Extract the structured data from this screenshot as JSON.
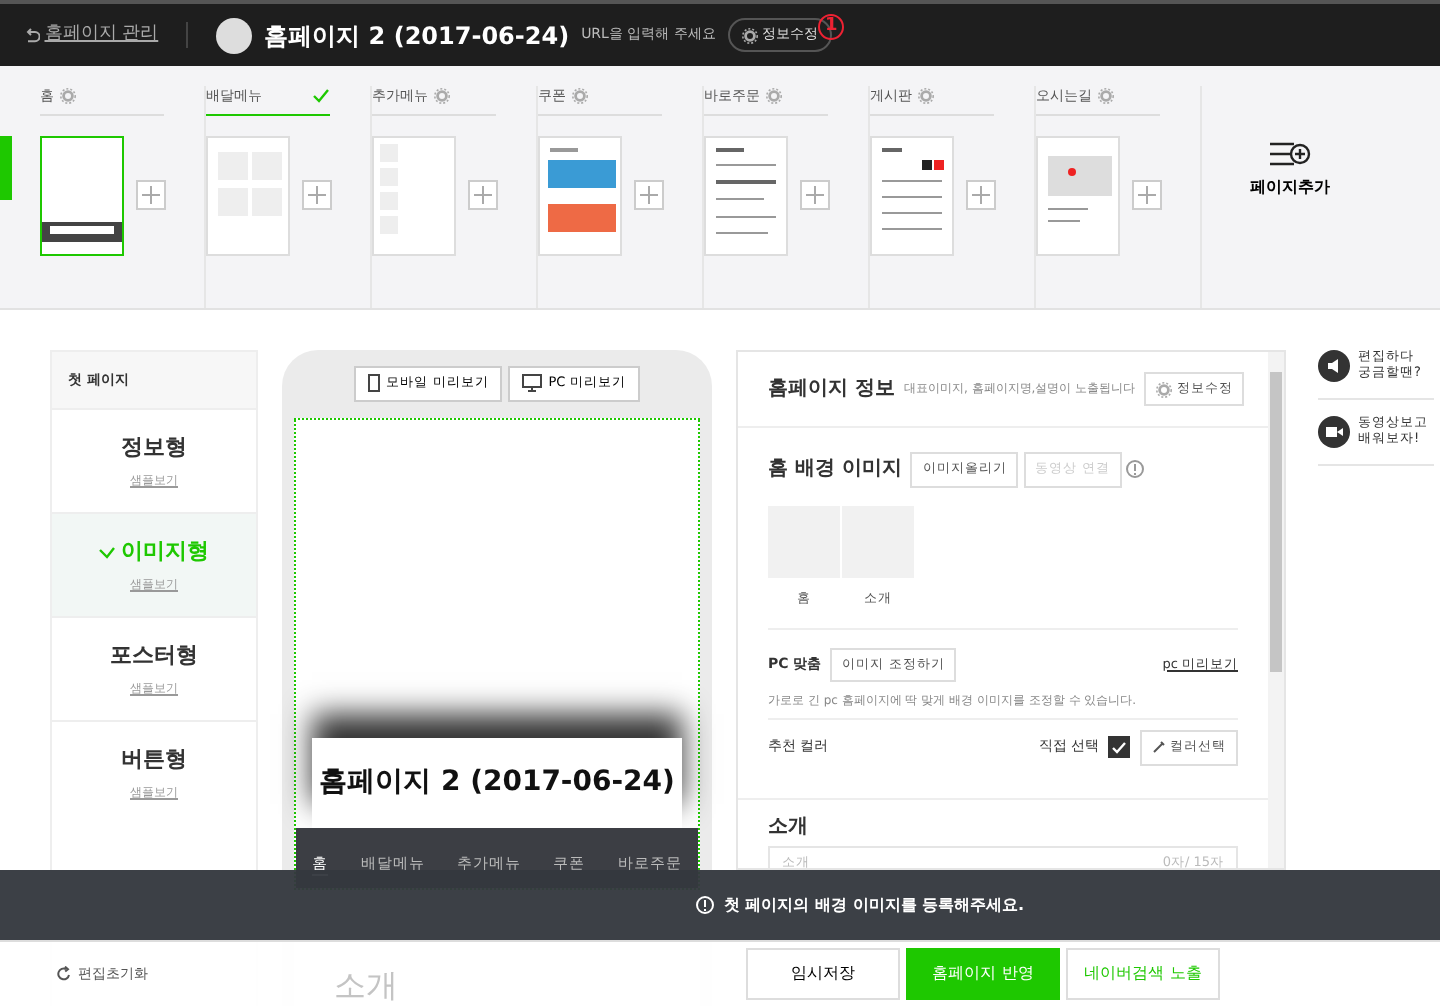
{
  "header": {
    "back_label": "홈페이지 관리",
    "site_title": "홈페이지 2 (2017-06-24)",
    "url_hint": "URL을 입력해 주세요",
    "edit_button": "정보수정",
    "step_marker": "1"
  },
  "pages": [
    {
      "label": "홈",
      "selected": false,
      "current": true,
      "kind": "home"
    },
    {
      "label": "배달메뉴",
      "selected": true,
      "current": false,
      "kind": "grid"
    },
    {
      "label": "추가메뉴",
      "selected": false,
      "current": false,
      "kind": "list"
    },
    {
      "label": "쿠폰",
      "selected": false,
      "current": false,
      "kind": "coupon"
    },
    {
      "label": "바로주문",
      "selected": false,
      "current": false,
      "kind": "order"
    },
    {
      "label": "게시판",
      "selected": false,
      "current": false,
      "kind": "board"
    },
    {
      "label": "오시는길",
      "selected": false,
      "current": false,
      "kind": "map"
    }
  ],
  "add_page": "페이지추가",
  "first_page": {
    "title": "첫 페이지",
    "types": [
      {
        "name": "정보형",
        "sample": "샘플보기",
        "selected": false
      },
      {
        "name": "이미지형",
        "sample": "샘플보기",
        "selected": true
      },
      {
        "name": "포스터형",
        "sample": "샘플보기",
        "selected": false
      },
      {
        "name": "버튼형",
        "sample": "샘플보기",
        "selected": false
      }
    ]
  },
  "preview": {
    "buttons": [
      {
        "label": "모바일 미리보기",
        "kind": "mobile"
      },
      {
        "label": "PC 미리보기",
        "kind": "pc"
      }
    ],
    "site_title": "홈페이지 2 (2017-06-24)",
    "nav": [
      {
        "label": "홈",
        "selected": true
      },
      {
        "label": "배달메뉴",
        "selected": false
      },
      {
        "label": "추가메뉴",
        "selected": false
      },
      {
        "label": "쿠폰",
        "selected": false
      },
      {
        "label": "바로주문",
        "selected": false
      }
    ],
    "section_title": "소개"
  },
  "info_panel": {
    "title": "홈페이지 정보",
    "subtitle": "대표이미지, 홈페이지명,설명이 노출됩니다",
    "edit_button": "정보수정",
    "bg_title": "홈 배경 이미지",
    "upload_button": "이미지올리기",
    "video_button": {
      "label": "동영상 연결",
      "disabled": true
    },
    "thumbs": [
      "홈",
      "소개"
    ],
    "pc_label": "PC 맞춤",
    "adjust_button": "이미지 조정하기",
    "pc_preview_link": "pc 미리보기",
    "pc_desc": "가로로 긴 pc 홈페이지에 딱 맞게 배경 이미지를 조정할 수 있습니다.",
    "color_label": "추천 컬러",
    "direct_label": "직접 선택",
    "direct_checked": true,
    "color_button": "컬러선택",
    "intro_title": "소개",
    "intro_placeholder": "소개",
    "intro_count": "0자/ 15자"
  },
  "help_links": [
    {
      "lines": [
        "편집하다",
        "궁금할땐?"
      ],
      "kind": "megaphone"
    },
    {
      "lines": [
        "동영상보고",
        "배워보자!"
      ],
      "kind": "video"
    }
  ],
  "toast": "첫 페이지의 배경 이미지를 등록해주세요.",
  "footer": {
    "reset": "편집초기화",
    "buttons": [
      {
        "label": "임시저장",
        "kind": "plain"
      },
      {
        "label": "홈페이지 반영",
        "kind": "primary"
      },
      {
        "label": "네이버검색 노출",
        "kind": "outline"
      }
    ]
  }
}
